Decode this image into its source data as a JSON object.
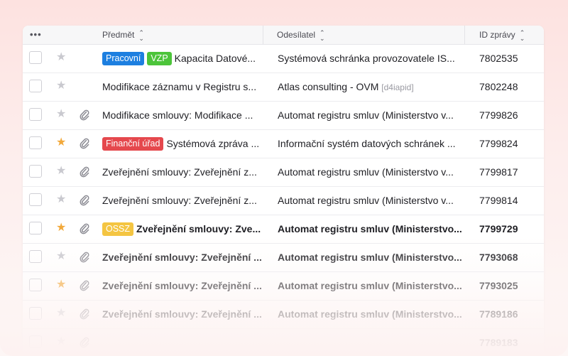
{
  "header": {
    "more_label": "•••",
    "subject_label": "Předmět",
    "sender_label": "Odesílatel",
    "msgid_label": "ID zprávy",
    "sort_icon": "sort-updown-icon"
  },
  "colors": {
    "tag_blue": "#1d7fe0",
    "tag_green": "#4cc43a",
    "tag_red": "#e5484d",
    "tag_yellow": "#f4c542",
    "star_active": "#f2a93b",
    "star_inactive": "#c9c9cf"
  },
  "rows": [
    {
      "starred": false,
      "attachment": false,
      "tags": [
        {
          "label": "Pracovní",
          "color": "#1d7fe0"
        },
        {
          "label": "VZP",
          "color": "#4cc43a"
        }
      ],
      "subject": "Kapacita Datové...",
      "sender": "Systémová schránka provozovatele IS...",
      "sender_suffix": "",
      "id": "7802535",
      "unread": false
    },
    {
      "starred": false,
      "attachment": false,
      "tags": [],
      "subject": "Modifikace záznamu v Registru s...",
      "sender": "Atlas consulting - OVM",
      "sender_suffix": "[d4iapid]",
      "id": "7802248",
      "unread": false
    },
    {
      "starred": false,
      "attachment": true,
      "tags": [],
      "subject": "Modifikace smlouvy: Modifikace ...",
      "sender": "Automat registru smluv (Ministerstvo v...",
      "sender_suffix": "",
      "id": "7799826",
      "unread": false
    },
    {
      "starred": true,
      "attachment": true,
      "tags": [
        {
          "label": "Finanční úřad",
          "color": "#e5484d"
        }
      ],
      "subject": "Systémová zpráva ...",
      "sender": "Informační systém datových schránek ...",
      "sender_suffix": "",
      "id": "7799824",
      "unread": false
    },
    {
      "starred": false,
      "attachment": true,
      "tags": [],
      "subject": "Zveřejnění smlouvy: Zveřejnění z...",
      "sender": "Automat registru smluv (Ministerstvo v...",
      "sender_suffix": "",
      "id": "7799817",
      "unread": false
    },
    {
      "starred": false,
      "attachment": true,
      "tags": [],
      "subject": "Zveřejnění smlouvy: Zveřejnění z...",
      "sender": "Automat registru smluv (Ministerstvo v...",
      "sender_suffix": "",
      "id": "7799814",
      "unread": false
    },
    {
      "starred": true,
      "attachment": true,
      "tags": [
        {
          "label": "OSSZ",
          "color": "#f4c542"
        }
      ],
      "subject": "Zveřejnění smlouvy: Zve...",
      "sender": "Automat registru smluv (Ministerstvo...",
      "sender_suffix": "",
      "id": "7799729",
      "unread": true
    },
    {
      "starred": false,
      "attachment": true,
      "tags": [],
      "subject": "Zveřejnění smlouvy: Zveřejnění ...",
      "sender": "Automat registru smluv (Ministerstvo...",
      "sender_suffix": "",
      "id": "7793068",
      "unread": true
    },
    {
      "starred": true,
      "attachment": true,
      "tags": [],
      "subject": "Zveřejnění smlouvy: Zveřejnění ...",
      "sender": "Automat registru smluv (Ministerstvo...",
      "sender_suffix": "",
      "id": "7793025",
      "unread": true
    },
    {
      "starred": false,
      "attachment": true,
      "tags": [],
      "subject": "Zveřejnění smlouvy: Zveřejnění ...",
      "sender": "Automat registru smluv (Ministerstvo...",
      "sender_suffix": "",
      "id": "7789186",
      "unread": true
    },
    {
      "starred": false,
      "attachment": true,
      "tags": [],
      "subject": "",
      "sender": "",
      "sender_suffix": "",
      "id": "7789183",
      "unread": true
    }
  ]
}
